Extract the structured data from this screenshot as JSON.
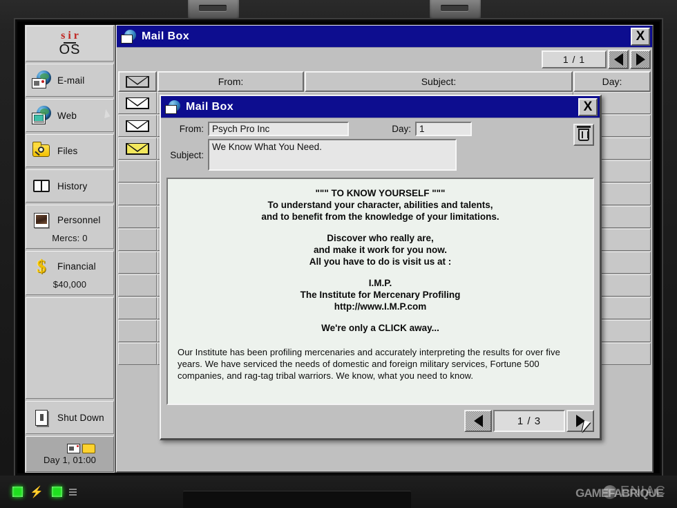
{
  "sidebar": {
    "logo": {
      "top": "sir",
      "bottom": "OS"
    },
    "items": [
      {
        "label": "E-mail",
        "icon": "email-globe-icon"
      },
      {
        "label": "Web",
        "icon": "web-globe-icon"
      },
      {
        "label": "Files",
        "icon": "folder-search-icon"
      },
      {
        "label": "History",
        "icon": "book-icon"
      },
      {
        "label": "Personnel",
        "icon": "portrait-icon",
        "sub": "Mercs: 0"
      },
      {
        "label": "Financial",
        "icon": "dollar-icon",
        "sub": "$40,000"
      }
    ],
    "shutdown": {
      "label": "Shut Down",
      "icon": "power-switch-icon"
    },
    "clock": {
      "text": "Day 1, 01:00"
    }
  },
  "mailbox_window": {
    "title": "Mail Box",
    "close_label": "X",
    "page_counter": "1 / 1",
    "columns": [
      "",
      "From:",
      "Subject:",
      "Day:"
    ],
    "rows": [
      {
        "state": "read"
      },
      {
        "state": "read"
      },
      {
        "state": "unread"
      }
    ],
    "empty_row_count": 9
  },
  "mail_dialog": {
    "title": "Mail Box",
    "close_label": "X",
    "from_label": "From:",
    "from_value": "Psych Pro Inc",
    "day_label": "Day:",
    "day_value": "1",
    "subject_label": "Subject:",
    "subject_value": "We Know What You Need.",
    "delete_icon": "trash-icon",
    "page_counter": "1 / 3",
    "body": {
      "centered_lines": [
        "\"\"\" TO KNOW YOURSELF \"\"\"",
        "To understand your character, abilities and talents,",
        "and to benefit from the knowledge of your limitations.",
        "",
        "Discover who really are,",
        "and make it work for you now.",
        "All you have to do is visit us at :",
        "",
        "I.M.P.",
        "The Institute for Mercenary Profiling",
        "http://www.I.M.P.com",
        "",
        "We're only a CLICK away..."
      ],
      "paragraph": "Our Institute has been profiling mercenaries and accurately interpreting the results for over five years. We have serviced the needs of domestic and foreign military services, Fortune 500 companies, and rag-tag tribal warriors. We know, what you need to know."
    }
  },
  "chassis": {
    "brand": "ENIAC",
    "watermark": "GAMEFABRIQUE"
  },
  "colors": {
    "titlebar": "#0d0d8f",
    "face": "#c0c0c0",
    "mail_body": "#edf2ed",
    "unread": "#f2e75c",
    "logo_red": "#c0231f"
  }
}
